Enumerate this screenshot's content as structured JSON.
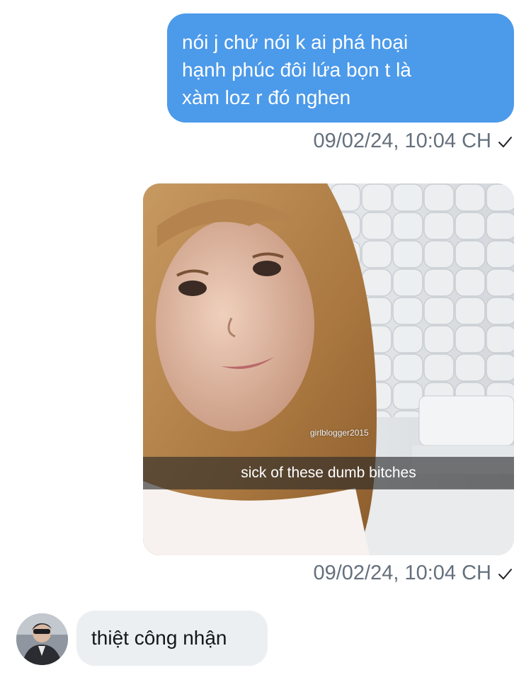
{
  "conversation": {
    "outgoing_text": {
      "lines": [
        "nói j chứ nói k ai phá hoại",
        "hạnh phúc đôi lứa bọn t là",
        "xàm loz r đó nghen"
      ],
      "timestamp": "09/02/24, 10:04 CH",
      "status_icon": "checkmark-sent-icon"
    },
    "outgoing_image": {
      "watermark": "girlblogger2015",
      "caption": "sick of these dumb bitches",
      "timestamp": "09/02/24, 10:04 CH",
      "status_icon": "checkmark-sent-icon"
    },
    "incoming_text": {
      "text": "thiệt công nhận",
      "avatar_icon": "user-avatar"
    }
  },
  "colors": {
    "outgoing_bubble": "#4c9aea",
    "incoming_bubble": "#eceff2",
    "timestamp": "#65707d"
  }
}
